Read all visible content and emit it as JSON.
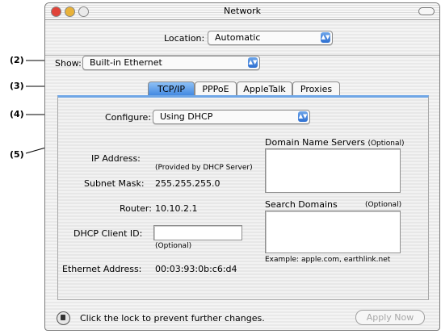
{
  "callouts": [
    "(2)",
    "(3)",
    "(4)",
    "(5)"
  ],
  "window": {
    "title": "Network",
    "location_label": "Location:",
    "location_value": "Automatic",
    "show_label": "Show:",
    "show_value": "Built-in Ethernet"
  },
  "tabs": [
    {
      "label": "TCP/IP",
      "active": true
    },
    {
      "label": "PPPoE",
      "active": false
    },
    {
      "label": "AppleTalk",
      "active": false
    },
    {
      "label": "Proxies",
      "active": false
    }
  ],
  "tcpip": {
    "configure_label": "Configure:",
    "configure_value": "Using DHCP",
    "ip_label": "IP Address:",
    "ip_note": "(Provided by DHCP Server)",
    "subnet_label": "Subnet Mask:",
    "subnet_value": "255.255.255.0",
    "router_label": "Router:",
    "router_value": "10.10.2.1",
    "dhcp_label": "DHCP Client ID:",
    "dhcp_value": "",
    "dhcp_note": "(Optional)",
    "ether_label": "Ethernet Address:",
    "ether_value": "00:03:93:0b:c6:d4",
    "dns_label": "Domain Name Servers",
    "dns_optional": "(Optional)",
    "search_label": "Search Domains",
    "search_optional": "(Optional)",
    "example": "Example: apple.com, earthlink.net"
  },
  "footer": {
    "lock_text": "Click the lock to prevent further changes.",
    "apply_label": "Apply Now"
  },
  "colors": {
    "accent": "#3f86e0",
    "traffic_red": "#e0443a",
    "traffic_yellow": "#e8b23a"
  }
}
